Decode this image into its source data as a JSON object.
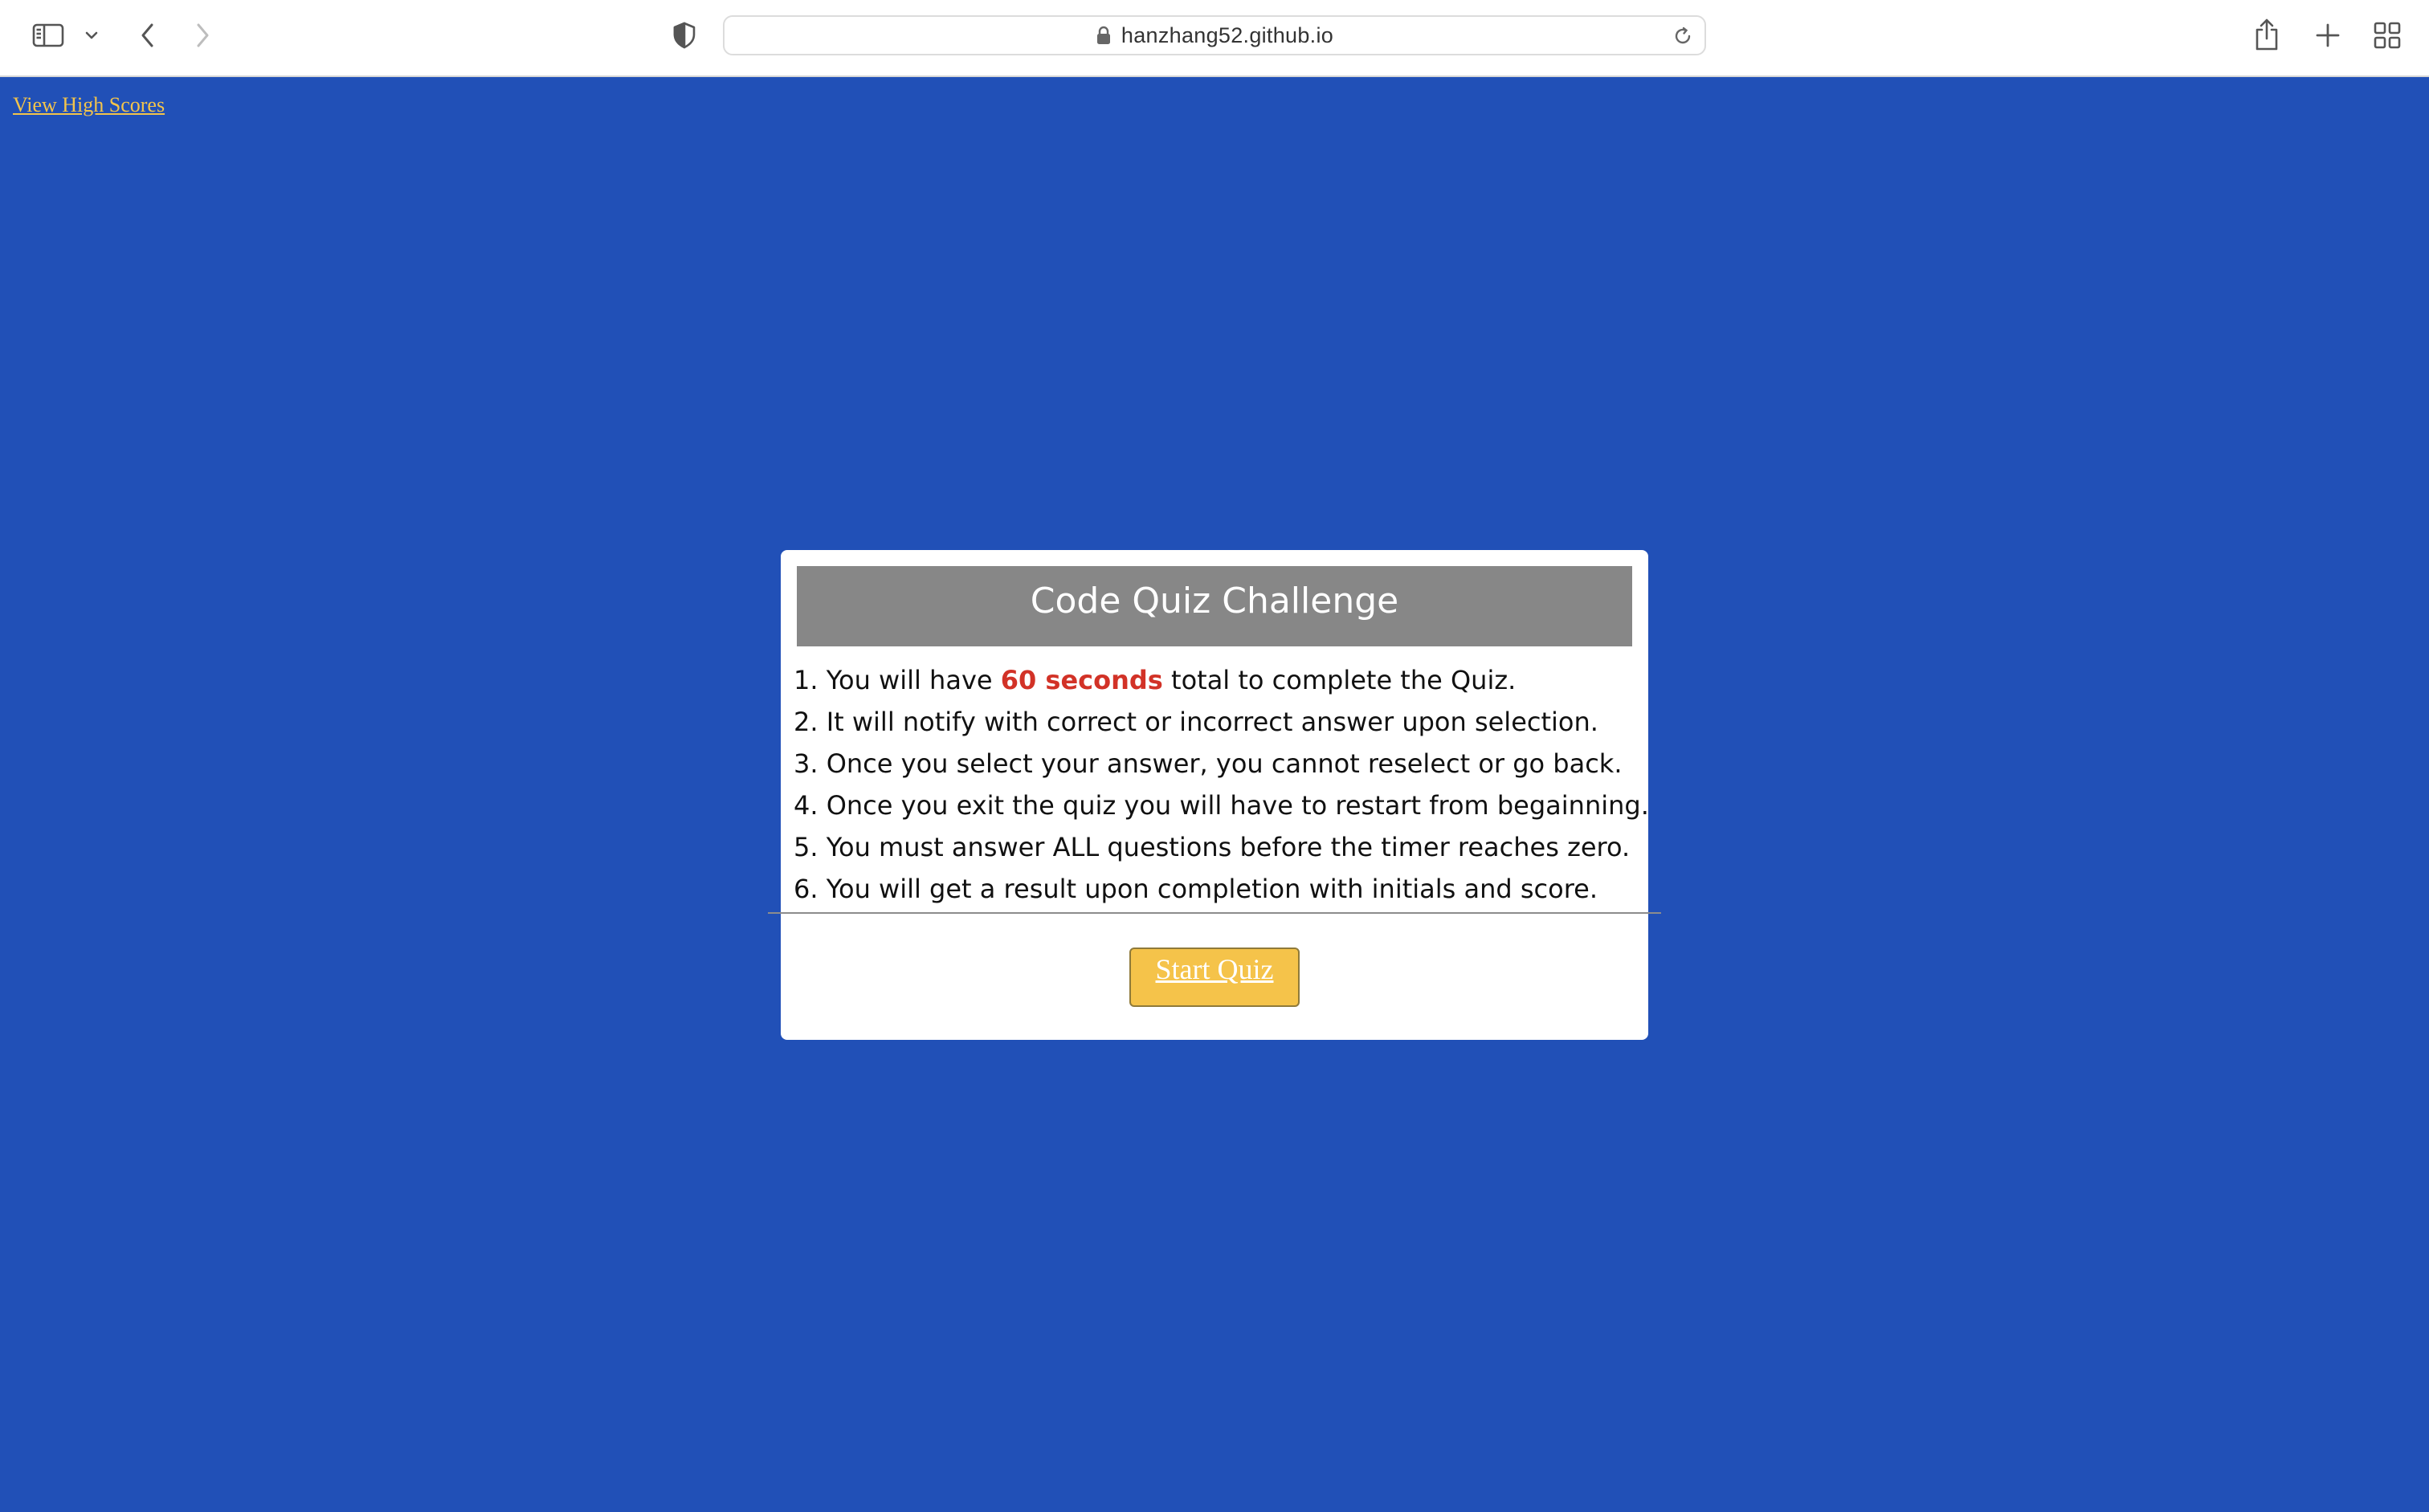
{
  "browser": {
    "url": "hanzhang52.github.io",
    "icons": {
      "sidebar": "sidebar-icon",
      "sidebar_menu": "chevron-down-icon",
      "back": "chevron-left-icon",
      "forward": "chevron-right-icon",
      "privacy": "shield-icon",
      "lock": "lock-icon",
      "reload": "reload-icon",
      "share": "share-icon",
      "new_tab": "plus-icon",
      "tab_overview": "grid-icon"
    }
  },
  "page": {
    "high_scores_link": "View High Scores",
    "quiz": {
      "title": "Code Quiz Challenge",
      "rules": [
        {
          "prefix": "1. You will have ",
          "highlight": "60 seconds",
          "suffix": " total to complete the Quiz."
        },
        {
          "text": "2. It will notify with correct or incorrect answer upon selection."
        },
        {
          "text": "3. Once you select your answer, you cannot reselect or go back."
        },
        {
          "text": "4. Once you exit the quiz you will have to restart from begainning."
        },
        {
          "text": "5. You must answer ALL questions before the timer reaches zero."
        },
        {
          "text": "6. You will get a result upon completion with initials and score."
        }
      ],
      "start_button": "Start Quiz"
    }
  },
  "colors": {
    "page_background": "#2150b7",
    "header_background": "#878787",
    "highlight_text": "#d23227",
    "button_background": "#f5c34a",
    "link_color": "#f3c44b"
  }
}
